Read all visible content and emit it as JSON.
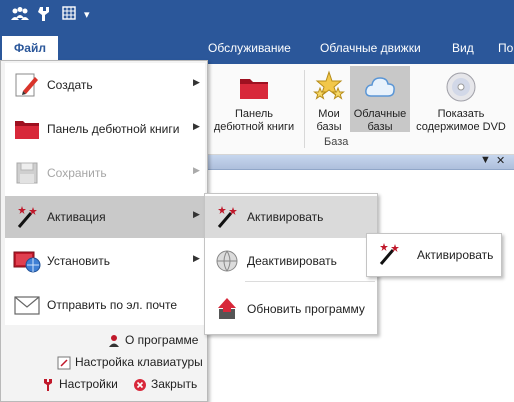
{
  "quick_access": {
    "icons": [
      "people-icon",
      "wrench-icon",
      "grid-icon",
      "dropdown-arrow-icon"
    ],
    "dropdown_glyph": "▾"
  },
  "ribbon": {
    "file_tab": "Файл",
    "tabs": [
      "Обслуживание",
      "Облачные движки",
      "Вид",
      "По"
    ],
    "buttons": [
      {
        "label_line1": "Панель",
        "label_line2": "дебютной книги",
        "icon": "red-folder-icon"
      },
      {
        "label_line1": "Мои",
        "label_line2": "базы",
        "icon": "stars-icon"
      },
      {
        "label_line1": "Облачные",
        "label_line2": "базы",
        "icon": "cloud-icon",
        "active": true
      },
      {
        "label_line1": "Показать",
        "label_line2": "содержимое DVD",
        "icon": "dvd-icon"
      }
    ],
    "group_label": "База"
  },
  "panel_controls": {
    "dropdown": "▼",
    "close": "✕"
  },
  "file_menu": {
    "items": [
      {
        "label": "Создать",
        "icon": "pencil-document-icon",
        "has_submenu": true
      },
      {
        "label": "Панель дебютной книги",
        "icon": "red-folder-icon",
        "has_submenu": true
      },
      {
        "label": "Сохранить",
        "icon": "floppy-disk-icon",
        "has_submenu": true,
        "disabled": true
      },
      {
        "label": "Активация",
        "icon": "magic-wand-icon",
        "has_submenu": true,
        "selected": true
      },
      {
        "label": "Установить",
        "icon": "monitor-globe-icon",
        "has_submenu": true
      },
      {
        "label": "Отправить по эл. почте",
        "icon": "envelope-icon",
        "has_submenu": false
      }
    ],
    "arrow_glyph": "▶",
    "footer": {
      "about": "О программе",
      "keyboard": "Настройка клавиатуры",
      "settings": "Настройки",
      "close": "Закрыть"
    }
  },
  "activation_submenu": {
    "items": [
      {
        "label": "Активировать",
        "icon": "magic-wand-icon",
        "selected": true
      },
      {
        "label": "Деактивировать",
        "icon": "globe-disc-icon"
      },
      {
        "label": "Обновить программу",
        "icon": "update-arrow-icon"
      }
    ]
  },
  "tooltip": {
    "label": "Активировать",
    "icon": "magic-wand-icon"
  },
  "colors": {
    "accent": "#2b579a",
    "selected": "#c9c9c9",
    "folder_red": "#c0182a"
  }
}
